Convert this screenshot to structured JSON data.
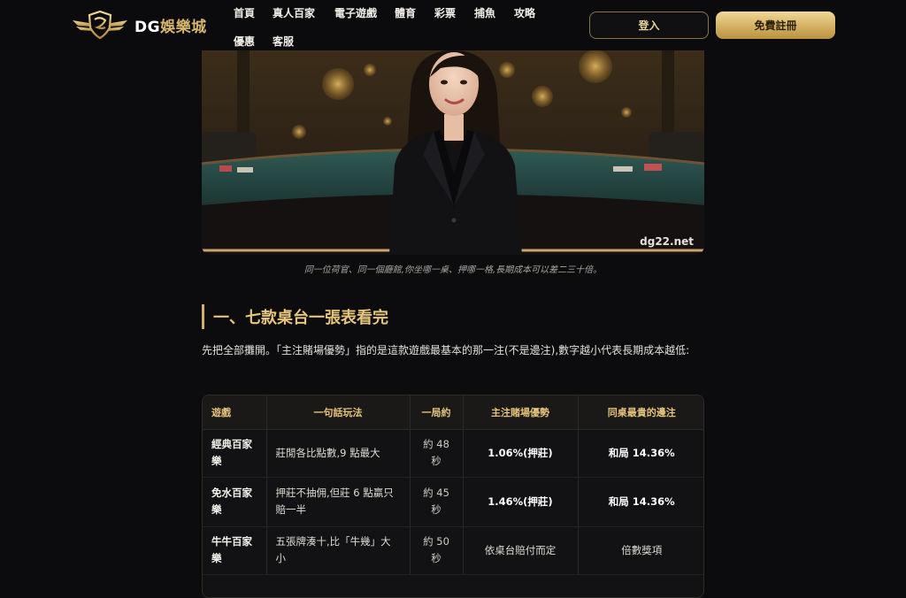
{
  "header": {
    "logo_text_en": "DG",
    "logo_text_cn": "娛樂城",
    "nav": [
      "首頁",
      "真人百家",
      "電子遊戲",
      "體育",
      "彩票",
      "捕魚",
      "攻略",
      "優惠",
      "客服"
    ],
    "login_label": "登入",
    "register_label": "免費註冊"
  },
  "hero": {
    "watermark": "dg22.net",
    "caption": "同一位荷官、同一個廳館,你坐哪一桌、押哪一格,長期成本可以差二三十倍。"
  },
  "section": {
    "title": "一、七款桌台一張表看完",
    "intro": "先把全部攤開。「主注賭場優勢」指的是這款遊戲最基本的那一注(不是邊注),數字越小代表長期成本越低:"
  },
  "table": {
    "headers": [
      "遊戲",
      "一句話玩法",
      "一局約",
      "主注賭場優勢",
      "同桌最貴的邊注"
    ],
    "rows": [
      {
        "game": "經典百家樂",
        "play": "莊閒各比點數,9 點最大",
        "round": "約 48 秒",
        "edge": "1.06%(押莊)",
        "side": "和局 14.36%"
      },
      {
        "game": "免水百家樂",
        "play": "押莊不抽佣,但莊 6 點贏只賠一半",
        "round": "約 45 秒",
        "edge": "1.46%(押莊)",
        "side": "和局 14.36%"
      },
      {
        "game": "牛牛百家樂",
        "play": "五張牌湊十,比「牛幾」大小",
        "round": "約 50 秒",
        "edge": "依桌台賠付而定",
        "side": "倍數獎項"
      }
    ]
  },
  "colors": {
    "background": "#0c0c0e",
    "gold_accent": "#d3b06a",
    "heading_gold": "#e6c57c"
  }
}
